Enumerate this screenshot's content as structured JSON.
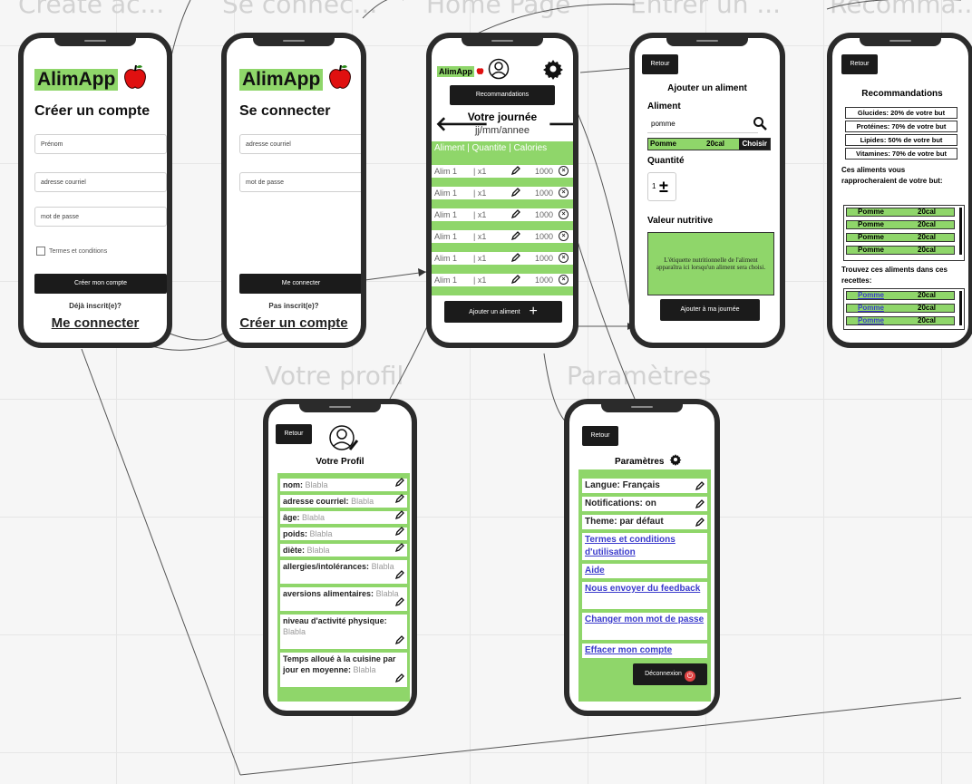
{
  "frame_titles": [
    "Create ac...",
    "Se connec...",
    "Home Page",
    "Entrer un ...",
    "Recomma...",
    "Votre profil",
    "Paramètres"
  ],
  "create_account": {
    "logo": "AlimApp",
    "title": "Créer un compte",
    "fields": [
      "Prénom",
      "adresse courriel",
      "mot de passe"
    ],
    "terms_label": "Termes et conditions",
    "submit_label": "Créer mon compte",
    "already_text": "Déjà inscrit(e)?",
    "login_link": "Me connecter"
  },
  "login": {
    "logo": "AlimApp",
    "title": "Se connecter",
    "fields": [
      "adresse courriel",
      "mot de passe"
    ],
    "submit_label": "Me connecter",
    "not_registered": "Pas inscrit(e)?",
    "create_link": "Créer un compte"
  },
  "home": {
    "logo": "AlimApp",
    "recommendations_label": "Recommandations",
    "day_title": "Votre journée",
    "date": "jj/mm/annee",
    "columns": "Aliment | Quantite | Calories",
    "rows": [
      {
        "name": "Alim 1",
        "qty": "| x1",
        "cal": "1000"
      },
      {
        "name": "Alim 1",
        "qty": "| x1",
        "cal": "1000"
      },
      {
        "name": "Alim 1",
        "qty": "| x1",
        "cal": "1000"
      },
      {
        "name": "Alim 1",
        "qty": "| x1",
        "cal": "1000"
      },
      {
        "name": "Alim 1",
        "qty": "| x1",
        "cal": "1000"
      },
      {
        "name": "Alim 1",
        "qty": "| x1",
        "cal": "1000"
      }
    ],
    "add_label": "Ajouter un aliment"
  },
  "add_food": {
    "back": "Retour",
    "title": "Ajouter un aliment",
    "food_label": "Aliment",
    "search_value": "pomme",
    "result_name": "Pomme",
    "result_cal": "20cal",
    "choose_label": "Choisir",
    "qty_label": "Quantité",
    "qty_value": "1",
    "nutrition_label": "Valeur nutritive",
    "nutrition_text": "L'étiquette nutritionnelle de l'aliment apparaîtra ici lorsqu'un aliment sera choisi.",
    "add_label": "Ajouter à ma journée"
  },
  "recommendations": {
    "back": "Retour",
    "title": "Recommandations",
    "goals": [
      "Glucides: 20% de votre but",
      "Protéines: 70% de votre but",
      "Lipides: 50% de votre but",
      "Vitamines: 70% de votre but"
    ],
    "closer_text": "Ces aliments vous rapprocheraient de votre but:",
    "closer_foods": [
      {
        "name": "Pomme",
        "cal": "20cal"
      },
      {
        "name": "Pomme",
        "cal": "20cal"
      },
      {
        "name": "Pomme",
        "cal": "20cal"
      },
      {
        "name": "Pomme",
        "cal": "20cal"
      }
    ],
    "recipes_text": "Trouvez ces aliments dans ces recettes:",
    "recipe_foods": [
      {
        "name": "Pomme",
        "cal": "20cal"
      },
      {
        "name": "Pomme",
        "cal": "20cal"
      },
      {
        "name": "Pomme",
        "cal": "20cal"
      }
    ]
  },
  "profile": {
    "back": "Retour",
    "title": "Votre Profil",
    "fields": [
      {
        "label": "nom:",
        "value": "Blabla"
      },
      {
        "label": "adresse courriel:",
        "value": "Blabla"
      },
      {
        "label": "âge:",
        "value": "Blabla"
      },
      {
        "label": "poids:",
        "value": "Blabla"
      },
      {
        "label": "diète:",
        "value": "Blabla"
      },
      {
        "label": "allergies/intolérances:",
        "value": "Blabla"
      },
      {
        "label": "aversions alimentaires:",
        "value": "Blabla"
      },
      {
        "label": "niveau d'activité physique:",
        "value": "Blabla"
      },
      {
        "label": "Temps alloué à la cuisine par jour en moyenne:",
        "value": "Blabla"
      }
    ]
  },
  "settings": {
    "back": "Retour",
    "title": "Paramètres",
    "items": [
      "Langue: Français",
      "Notifications: on",
      "Theme: par défaut"
    ],
    "links": [
      "Termes et conditions d'utilisation",
      "Aide",
      "Nous envoyer du feedback",
      "Changer mon mot de passe",
      "Effacer mon compte"
    ],
    "logout_label": "Déconnexion"
  },
  "colors": {
    "accent_green": "#8fd66a",
    "dark": "#1b1b1b",
    "link_blue": "#3b3bcc",
    "logout_red": "#e04444"
  }
}
